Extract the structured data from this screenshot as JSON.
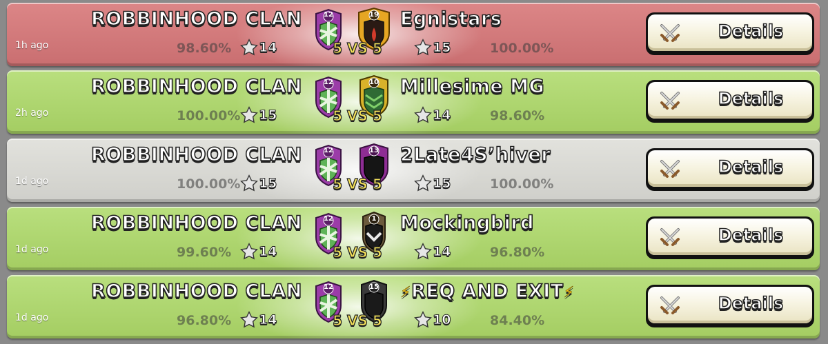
{
  "colors": {
    "loss": "#cf7677",
    "win": "#acd46b",
    "draw": "#d8d8d3",
    "vs_text": "#f6e35a"
  },
  "wars": [
    {
      "result": "loss",
      "time": "1h ago",
      "clan": {
        "name": "ROBBINHOOD CLAN",
        "level": "12",
        "percent": "98.60%",
        "stars": "14"
      },
      "opponent": {
        "name": "Egnistars",
        "level": "19",
        "percent": "100.00%",
        "stars": "15",
        "badge_color": "#e6a623"
      },
      "size": "5 VS 5",
      "details_label": "Details"
    },
    {
      "result": "win",
      "time": "2h ago",
      "clan": {
        "name": "ROBBINHOOD CLAN",
        "level": "12",
        "percent": "100.00%",
        "stars": "15"
      },
      "opponent": {
        "name": "Millesime MG",
        "level": "10",
        "percent": "98.60%",
        "stars": "14",
        "badge_color": "#d8b22a"
      },
      "size": "5 VS 5",
      "details_label": "Details"
    },
    {
      "result": "draw",
      "time": "1d ago",
      "clan": {
        "name": "ROBBINHOOD CLAN",
        "level": "12",
        "percent": "100.00%",
        "stars": "15"
      },
      "opponent": {
        "name": "2Late4S’hiver",
        "level": "13",
        "percent": "100.00%",
        "stars": "15",
        "badge_color": "#8e2d94"
      },
      "size": "5 VS 5",
      "details_label": "Details"
    },
    {
      "result": "win",
      "time": "1d ago",
      "clan": {
        "name": "ROBBINHOOD CLAN",
        "level": "12",
        "percent": "99.60%",
        "stars": "14"
      },
      "opponent": {
        "name": "Mockingbird",
        "level": "1",
        "percent": "96.80%",
        "stars": "14",
        "badge_color": "#6b5a3c"
      },
      "size": "5 VS 5",
      "details_label": "Details"
    },
    {
      "result": "win",
      "time": "1d ago",
      "clan": {
        "name": "ROBBINHOOD CLAN",
        "level": "12",
        "percent": "96.80%",
        "stars": "14"
      },
      "opponent": {
        "name": "REQ AND EXIT",
        "level": "15",
        "percent": "84.40%",
        "stars": "10",
        "badge_color": "#3a3a3a",
        "bolts": "⚡"
      },
      "size": "5 VS 5",
      "details_label": "Details"
    }
  ]
}
